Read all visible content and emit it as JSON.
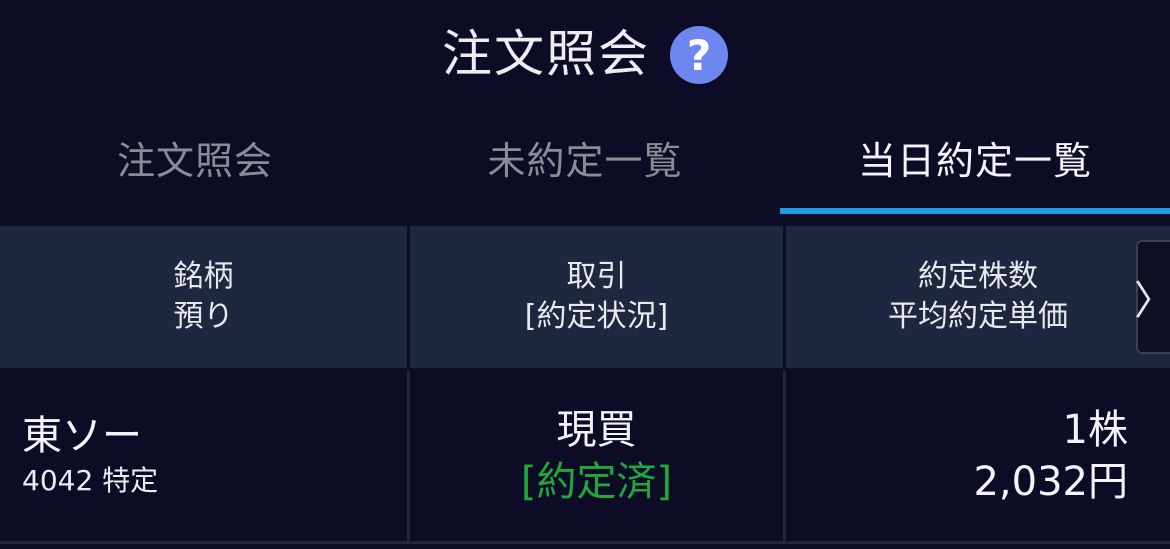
{
  "header": {
    "title": "注文照会",
    "help_glyph": "?",
    "help_icon": "question-circle-icon",
    "help_color": "#6e86f0"
  },
  "tabs": [
    {
      "label": "注文照会",
      "active": false
    },
    {
      "label": "未約定一覧",
      "active": false
    },
    {
      "label": "当日約定一覧",
      "active": true
    }
  ],
  "colors": {
    "background": "#0c0c27",
    "header_row": "#1e2640",
    "accent": "#1f9be2",
    "status_green": "#1fa83c"
  },
  "table": {
    "columns": [
      {
        "line1": "銘柄",
        "line2": "預り"
      },
      {
        "line1": "取引",
        "line2": "[約定状況]"
      },
      {
        "line1": "約定株数",
        "line2": "平均約定単価"
      }
    ],
    "scroll_glyph": "〉",
    "scroll_icon": "chevron-right-icon",
    "rows": [
      {
        "name": "東ソー",
        "code_account": "4042 特定",
        "trade": "現買",
        "status": "[約定済]",
        "quantity": "1株",
        "price": "2,032円"
      }
    ]
  }
}
